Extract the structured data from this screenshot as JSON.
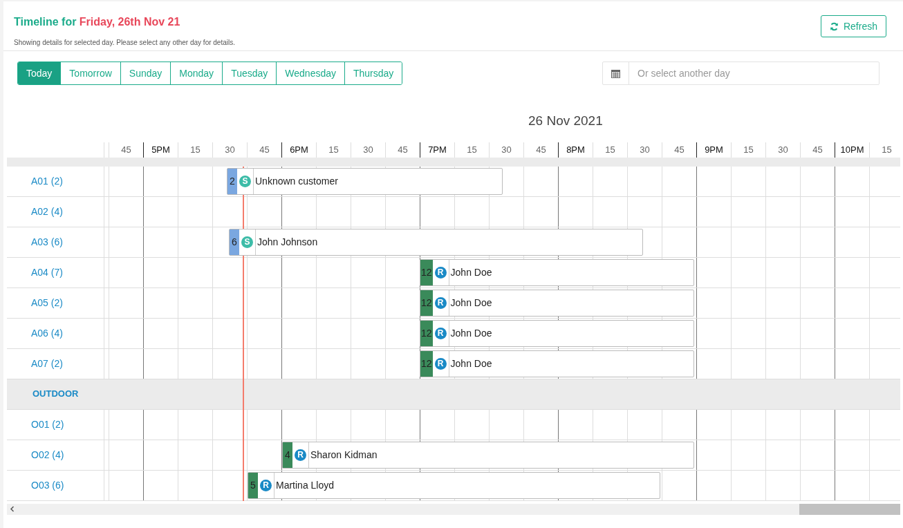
{
  "header": {
    "title_prefix": "Timeline for",
    "title_date": "Friday, 26th Nov 21",
    "subtitle": "Showing details for selected day. Please select any other day for details.",
    "refresh_button": "Refresh"
  },
  "day_tabs": [
    {
      "label": "Today",
      "selected": true
    },
    {
      "label": "Tomorrow",
      "selected": false
    },
    {
      "label": "Sunday",
      "selected": false
    },
    {
      "label": "Monday",
      "selected": false
    },
    {
      "label": "Tuesday",
      "selected": false
    },
    {
      "label": "Wednesday",
      "selected": false
    },
    {
      "label": "Thursday",
      "selected": false
    }
  ],
  "date_picker": {
    "placeholder": "Or select another day"
  },
  "timeline": {
    "date_heading": "26 Nov 2021",
    "time_slots": [
      {
        "label": "45",
        "hour": false
      },
      {
        "label": "5PM",
        "hour": true
      },
      {
        "label": "15",
        "hour": false
      },
      {
        "label": "30",
        "hour": false
      },
      {
        "label": "45",
        "hour": false
      },
      {
        "label": "6PM",
        "hour": true
      },
      {
        "label": "15",
        "hour": false
      },
      {
        "label": "30",
        "hour": false
      },
      {
        "label": "45",
        "hour": false
      },
      {
        "label": "7PM",
        "hour": true
      },
      {
        "label": "15",
        "hour": false
      },
      {
        "label": "30",
        "hour": false
      },
      {
        "label": "45",
        "hour": false
      },
      {
        "label": "8PM",
        "hour": true
      },
      {
        "label": "15",
        "hour": false
      },
      {
        "label": "30",
        "hour": false
      },
      {
        "label": "45",
        "hour": false
      },
      {
        "label": "9PM",
        "hour": true
      },
      {
        "label": "15",
        "hour": false
      },
      {
        "label": "30",
        "hour": false
      },
      {
        "label": "45",
        "hour": false
      },
      {
        "label": "10PM",
        "hour": true
      },
      {
        "label": "15",
        "hour": false
      }
    ],
    "rows": [
      {
        "kind": "table",
        "label": "A01 (2)",
        "bookings": [
          {
            "kind": "s",
            "covers": "2",
            "badge": "S",
            "color": "#7aa7e0",
            "name": "Unknown customer"
          }
        ]
      },
      {
        "kind": "table",
        "label": "A02 (4)"
      },
      {
        "kind": "table",
        "label": "A03 (6)",
        "bookings": [
          {
            "kind": "s",
            "covers": "6",
            "badge": "S",
            "color": "#7aa7e0",
            "name": "John Johnson"
          }
        ]
      },
      {
        "kind": "table",
        "label": "A04 (7)",
        "bookings": [
          {
            "kind": "r",
            "covers": "12",
            "badge": "R",
            "color": "#3a8a5a",
            "name": "John Doe"
          }
        ]
      },
      {
        "kind": "table",
        "label": "A05 (2)",
        "bookings": [
          {
            "kind": "r",
            "covers": "12",
            "badge": "R",
            "color": "#3a8a5a",
            "name": "John Doe"
          }
        ]
      },
      {
        "kind": "table",
        "label": "A06 (4)",
        "bookings": [
          {
            "kind": "r",
            "covers": "12",
            "badge": "R",
            "color": "#3a8a5a",
            "name": "John Doe"
          }
        ]
      },
      {
        "kind": "table",
        "label": "A07 (2)",
        "bookings": [
          {
            "kind": "r",
            "covers": "12",
            "badge": "R",
            "color": "#3a8a5a",
            "name": "John Doe"
          }
        ]
      },
      {
        "kind": "section",
        "label": "OUTDOOR"
      },
      {
        "kind": "table",
        "label": "O01 (2)"
      },
      {
        "kind": "table",
        "label": "O02 (4)",
        "bookings": [
          {
            "kind": "r",
            "covers": "4",
            "badge": "R",
            "color": "#3a8a5a",
            "name": "Sharon Kidman"
          }
        ]
      },
      {
        "kind": "table",
        "label": "O03 (6)",
        "bookings": [
          {
            "kind": "r",
            "covers": "5",
            "badge": "R",
            "color": "#3a8a5a",
            "name": "Martina Lloyd"
          }
        ]
      }
    ]
  }
}
